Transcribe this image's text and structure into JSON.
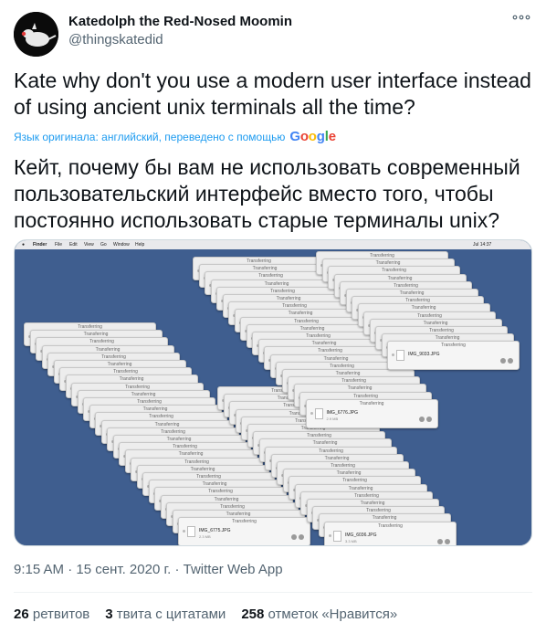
{
  "author": {
    "name": "Katedolph the Red-Nosed Moomin",
    "handle": "@thingskatedid"
  },
  "more_label": "ooo",
  "tweet": {
    "original_text": "Kate why don't you use a modern user interface instead of using ancient unix terminals all the time?",
    "translation_note": "Язык оригинала: английский, переведено с помощью",
    "translator_brand": [
      "G",
      "o",
      "o",
      "g",
      "l",
      "e"
    ],
    "translated_text": "Кейт, почему бы вам не использовать современный пользовательский интерфейс вместо того, чтобы постоянно использовать старые терминалы unix?"
  },
  "media": {
    "menubar": {
      "apple": "",
      "items": [
        "Finder",
        "File",
        "Edit",
        "View",
        "Go",
        "Window",
        "Help"
      ],
      "clock": "Jul 14:37"
    },
    "window_title": "Transferring",
    "files": [
      {
        "name": "IMG_6775.JPG",
        "size": "2.3 MB"
      },
      {
        "name": "IMG_6036.JPG",
        "size": "3.3 MB"
      },
      {
        "name": "IMG_6776.JPG",
        "size": "2.9 MB"
      },
      {
        "name": "IMG_9033.JPG",
        "size": ""
      }
    ]
  },
  "meta": {
    "time": "9:15 AM",
    "sep": "·",
    "date": "15 сент. 2020 г.",
    "client": "Twitter Web App"
  },
  "stats": [
    {
      "count": "26",
      "label": "ретвитов"
    },
    {
      "count": "3",
      "label": "твита с цитатами"
    },
    {
      "count": "258",
      "label": "отметок «Нравится»"
    }
  ],
  "colors": {
    "link": "#1d9bf0",
    "muted": "#536471",
    "desktop": "#3f5e8f"
  }
}
